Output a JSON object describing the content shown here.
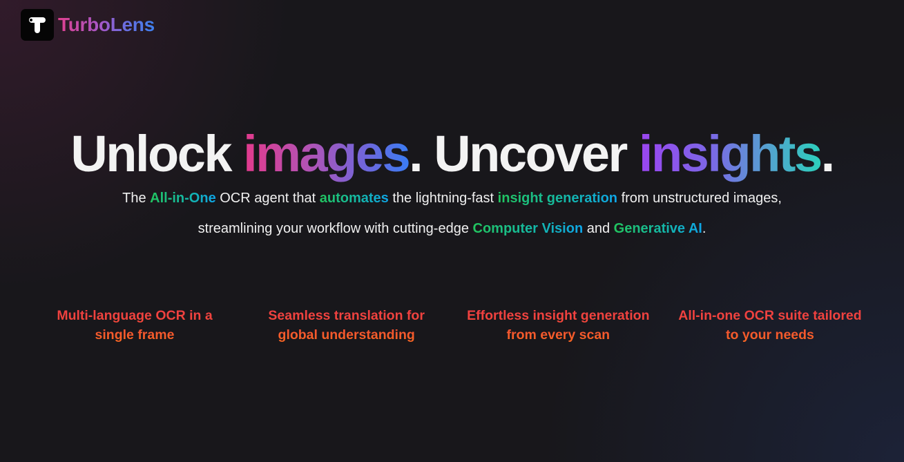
{
  "header": {
    "brand_name": "TurboLens",
    "logo_icon": "t-letter-logo-icon"
  },
  "hero": {
    "headline": {
      "part1": "Unlock ",
      "highlight1": "images",
      "part2": ". Uncover ",
      "highlight2": "insights",
      "part3": "."
    },
    "subtitle_line1": {
      "t1": "The ",
      "h1": "All-in-One",
      "t2": " OCR agent that ",
      "h2": "automates",
      "t3": " the lightning-fast ",
      "h3": "insight generation",
      "t4": " from unstructured images,"
    },
    "subtitle_line2": {
      "t1": "streamlining your workflow with cutting-edge ",
      "h1": "Computer Vision",
      "t2": " and ",
      "h2": "Generative AI",
      "t3": "."
    }
  },
  "features": [
    {
      "line1": "Multi-language OCR in a",
      "line2": "single frame"
    },
    {
      "line1": "Seamless translation for",
      "line2": "global understanding"
    },
    {
      "line1": "Effortless insight generation",
      "line2": "from every scan"
    },
    {
      "line1": "All-in-one OCR suite tailored",
      "line2": "to your needs"
    }
  ],
  "colors": {
    "background": "#18171b",
    "headline_text": "#f3f3f3",
    "highlight_green": "#22c55e",
    "highlight_blue": "#0ea5e9",
    "feature_red": "#ee3b44",
    "feature_orange": "#f86a1f"
  }
}
